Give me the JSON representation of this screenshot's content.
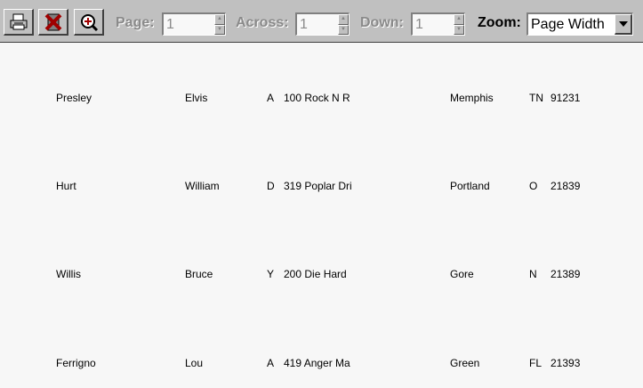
{
  "toolbar": {
    "print_button": "print",
    "close_button": "close",
    "zoom_button": "zoom",
    "page_label": "Page:",
    "page_value": "1",
    "across_label": "Across:",
    "across_value": "1",
    "down_label": "Down:",
    "down_value": "1",
    "zoom_label": "Zoom:",
    "zoom_value": "Page Width"
  },
  "records": [
    {
      "last": "Presley",
      "first": "Elvis",
      "mi": "A",
      "address": "100 Rock N R",
      "city": "Memphis",
      "state": "TN",
      "zip": "91231"
    },
    {
      "last": "Hurt",
      "first": "William",
      "mi": "D",
      "address": "319 Poplar Dri",
      "city": "Portland",
      "state": "O",
      "zip": "21839"
    },
    {
      "last": "Willis",
      "first": "Bruce",
      "mi": "Y",
      "address": "200 Die Hard",
      "city": "Gore",
      "state": "N",
      "zip": "21389"
    },
    {
      "last": "Ferrigno",
      "first": "Lou",
      "mi": "A",
      "address": "419 Anger Ma",
      "city": "Green",
      "state": "FL",
      "zip": "21393"
    }
  ]
}
